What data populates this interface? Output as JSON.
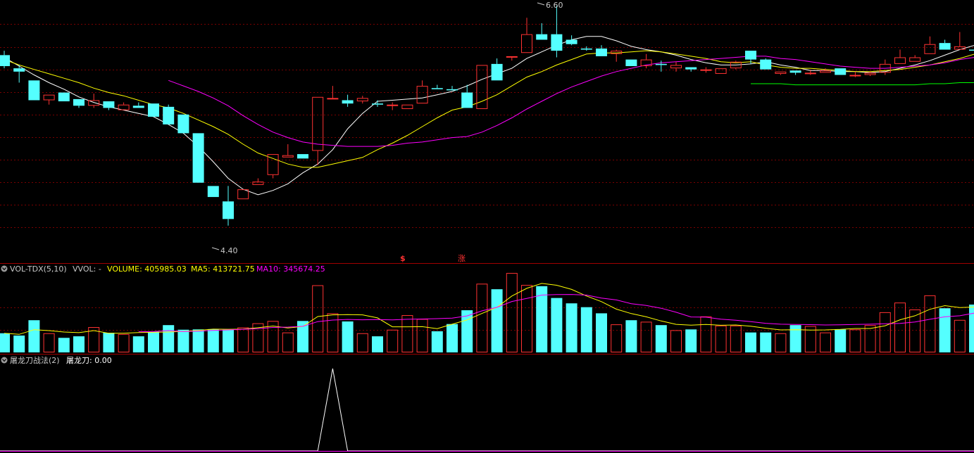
{
  "colors": {
    "background": "#000000",
    "up": "#ff3232",
    "down": "#54ffff",
    "ma_white": "#ffffff",
    "ma_yellow": "#ffff00",
    "ma_magenta": "#ff00ff",
    "ma_green": "#00ff00",
    "grid": "#7a0000",
    "divider": "#a00000",
    "header_gray": "#c8c8c8"
  },
  "price_panel": {
    "high_label": "6.60",
    "low_label": "4.40",
    "markers": [
      "$",
      "涨"
    ]
  },
  "volume_panel": {
    "indicator": "VOL-TDX(5,10)",
    "vvol": "VVOL: -",
    "volume": "VOLUME: 405985.03",
    "ma5": "MA5: 413721.75",
    "ma10": "MA10: 345674.25"
  },
  "signal_panel": {
    "indicator": "屠龙刀战法(2)",
    "value": "屠龙刀: 0.00"
  },
  "chart_data": [
    {
      "type": "candlestick",
      "price_axis_range": [
        4.4,
        6.6
      ],
      "high_annotation": 6.6,
      "low_annotation": 4.4,
      "candles": [
        [
          6.15,
          6.05,
          6.19,
          6.03
        ],
        [
          6.03,
          6.0,
          6.06,
          5.9
        ],
        [
          5.92,
          5.74,
          5.92,
          5.74
        ],
        [
          5.74,
          5.79,
          5.79,
          5.7
        ],
        [
          5.81,
          5.73,
          5.81,
          5.73
        ],
        [
          5.75,
          5.69,
          5.75,
          5.67
        ],
        [
          5.69,
          5.74,
          5.8,
          5.67
        ],
        [
          5.73,
          5.67,
          5.73,
          5.65
        ],
        [
          5.65,
          5.7,
          5.72,
          5.65
        ],
        [
          5.69,
          5.67,
          5.72,
          5.67
        ],
        [
          5.71,
          5.59,
          5.71,
          5.59
        ],
        [
          5.68,
          5.52,
          5.7,
          5.52
        ],
        [
          5.61,
          5.44,
          5.61,
          5.44
        ],
        [
          5.44,
          4.99,
          5.44,
          4.99
        ],
        [
          4.96,
          4.86,
          4.96,
          4.86
        ],
        [
          4.82,
          4.66,
          4.96,
          4.6
        ],
        [
          4.84,
          4.93,
          4.93,
          4.84
        ],
        [
          4.97,
          5.0,
          5.03,
          4.97
        ],
        [
          5.06,
          5.25,
          5.25,
          5.03
        ],
        [
          5.22,
          5.24,
          5.34,
          5.22
        ],
        [
          5.25,
          5.21,
          5.25,
          5.21
        ],
        [
          5.28,
          5.77,
          5.77,
          5.15
        ],
        [
          5.75,
          5.76,
          5.87,
          5.75
        ],
        [
          5.74,
          5.71,
          5.79,
          5.68
        ],
        [
          5.73,
          5.76,
          5.78,
          5.71
        ],
        [
          5.71,
          5.7,
          5.74,
          5.68
        ],
        [
          5.69,
          5.7,
          5.72,
          5.65
        ],
        [
          5.66,
          5.7,
          5.7,
          5.66
        ],
        [
          5.71,
          5.87,
          5.92,
          5.71
        ],
        [
          5.85,
          5.84,
          5.88,
          5.84
        ],
        [
          5.84,
          5.83,
          5.87,
          5.83
        ],
        [
          5.81,
          5.67,
          5.88,
          5.67
        ],
        [
          5.66,
          6.06,
          6.06,
          5.66
        ],
        [
          6.07,
          5.92,
          6.12,
          5.92
        ],
        [
          6.13,
          6.14,
          6.14,
          6.1
        ],
        [
          6.17,
          6.34,
          6.49,
          6.17
        ],
        [
          6.34,
          6.29,
          6.44,
          6.29
        ],
        [
          6.34,
          6.19,
          6.6,
          6.13
        ],
        [
          6.29,
          6.25,
          6.33,
          6.24
        ],
        [
          6.21,
          6.2,
          6.23,
          6.19
        ],
        [
          6.21,
          6.14,
          6.24,
          6.14
        ],
        [
          6.16,
          6.19,
          6.2,
          6.09
        ],
        [
          6.11,
          6.05,
          6.11,
          6.05
        ],
        [
          6.05,
          6.11,
          6.16,
          6.03
        ],
        [
          6.07,
          6.06,
          6.1,
          6.0
        ],
        [
          6.03,
          6.06,
          6.09,
          6.0
        ],
        [
          6.04,
          6.02,
          6.04,
          6.0
        ],
        [
          6.01,
          6.02,
          6.04,
          5.99
        ],
        [
          5.98,
          6.03,
          6.03,
          5.98
        ],
        [
          6.03,
          6.09,
          6.1,
          6.02
        ],
        [
          6.19,
          6.11,
          6.19,
          6.07
        ],
        [
          6.11,
          6.02,
          6.12,
          6.02
        ],
        [
          5.98,
          6.0,
          6.0,
          5.97
        ],
        [
          6.01,
          5.99,
          6.01,
          5.97
        ],
        [
          5.99,
          5.99,
          6.01,
          5.97
        ],
        [
          5.99,
          6.01,
          6.03,
          5.99
        ],
        [
          6.03,
          5.97,
          6.03,
          5.97
        ],
        [
          5.97,
          5.97,
          6.0,
          5.95
        ],
        [
          5.97,
          5.99,
          6.0,
          5.96
        ],
        [
          5.99,
          6.07,
          6.11,
          5.97
        ],
        [
          6.07,
          6.13,
          6.2,
          6.07
        ],
        [
          6.09,
          6.13,
          6.15,
          6.09
        ],
        [
          6.16,
          6.25,
          6.32,
          6.16
        ],
        [
          6.26,
          6.2,
          6.29,
          6.2
        ],
        [
          6.2,
          6.23,
          6.36,
          6.2
        ],
        [
          6.2,
          6.19,
          6.34,
          6.18
        ],
        [
          6.23,
          6.29,
          6.35,
          6.19
        ]
      ],
      "ma_lines": [
        {
          "color": "white",
          "values": [
            6.13,
            6.05,
            5.97,
            5.9,
            5.84,
            5.77,
            5.72,
            5.68,
            5.65,
            5.62,
            5.59,
            5.52,
            5.44,
            5.32,
            5.18,
            5.03,
            4.93,
            4.88,
            4.92,
            4.98,
            5.08,
            5.16,
            5.29,
            5.48,
            5.62,
            5.73,
            5.74,
            5.75,
            5.76,
            5.79,
            5.82,
            5.87,
            5.93,
            5.98,
            6.03,
            6.12,
            6.18,
            6.24,
            6.29,
            6.32,
            6.32,
            6.28,
            6.23,
            6.2,
            6.18,
            6.15,
            6.11,
            6.08,
            6.06,
            6.06,
            6.07,
            6.09,
            6.06,
            6.04,
            6.01,
            6.01,
            6.0,
            6.0,
            5.99,
            6.0,
            6.03,
            6.06,
            6.1,
            6.15,
            6.2,
            6.24,
            6.25
          ]
        },
        {
          "color": "yellow",
          "values": [
            6.11,
            6.06,
            6.02,
            5.98,
            5.94,
            5.9,
            5.85,
            5.81,
            5.78,
            5.74,
            5.7,
            5.67,
            5.62,
            5.56,
            5.5,
            5.43,
            5.34,
            5.26,
            5.21,
            5.16,
            5.13,
            5.13,
            5.16,
            5.19,
            5.22,
            5.29,
            5.35,
            5.42,
            5.5,
            5.58,
            5.65,
            5.68,
            5.73,
            5.79,
            5.87,
            5.95,
            6.0,
            6.06,
            6.11,
            6.16,
            6.17,
            6.17,
            6.18,
            6.19,
            6.18,
            6.16,
            6.14,
            6.12,
            6.09,
            6.08,
            6.09,
            6.06,
            6.04,
            6.03,
            6.03,
            6.02,
            6.01,
            6.0,
            6.0,
            6.01,
            6.02,
            6.04,
            6.06,
            6.09,
            6.12,
            6.16,
            6.2
          ]
        },
        {
          "color": "magenta",
          "values": [
            null,
            null,
            null,
            null,
            null,
            null,
            null,
            null,
            null,
            null,
            null,
            5.92,
            5.87,
            5.82,
            5.76,
            5.69,
            5.6,
            5.52,
            5.45,
            5.4,
            5.36,
            5.34,
            5.33,
            5.32,
            5.32,
            5.32,
            5.33,
            5.35,
            5.36,
            5.38,
            5.4,
            5.41,
            5.45,
            5.51,
            5.58,
            5.66,
            5.73,
            5.8,
            5.86,
            5.91,
            5.96,
            6.0,
            6.03,
            6.06,
            6.08,
            6.09,
            6.1,
            6.11,
            6.12,
            6.13,
            6.14,
            6.14,
            6.12,
            6.11,
            6.09,
            6.07,
            6.05,
            6.04,
            6.03,
            6.03,
            6.04,
            6.05,
            6.06,
            6.08,
            6.11,
            6.13,
            6.15
          ]
        },
        {
          "color": "green",
          "values": [
            null,
            null,
            null,
            null,
            null,
            null,
            null,
            null,
            null,
            null,
            null,
            null,
            null,
            null,
            null,
            null,
            null,
            null,
            null,
            null,
            null,
            null,
            null,
            null,
            null,
            null,
            null,
            null,
            null,
            null,
            null,
            null,
            null,
            null,
            null,
            null,
            null,
            null,
            null,
            null,
            null,
            null,
            null,
            null,
            null,
            null,
            null,
            null,
            null,
            null,
            5.89,
            5.89,
            5.89,
            5.88,
            5.88,
            5.88,
            5.88,
            5.88,
            5.88,
            5.88,
            5.88,
            5.88,
            5.89,
            5.89,
            5.9,
            5.9,
            5.91
          ]
        }
      ],
      "signal_markers": [
        {
          "index": 26,
          "label": "$"
        },
        {
          "index": 30,
          "label": "涨"
        }
      ]
    },
    {
      "type": "bar",
      "title": "VOL-TDX(5,10)",
      "volume_range": [
        0,
        500000
      ],
      "values": [
        125000,
        110000,
        210000,
        125000,
        95000,
        105000,
        165000,
        128000,
        120000,
        105000,
        135000,
        178000,
        148000,
        150000,
        152000,
        148000,
        163000,
        190000,
        205000,
        130000,
        205000,
        438000,
        255000,
        202000,
        125000,
        105000,
        148000,
        243000,
        218000,
        138000,
        185000,
        275000,
        448000,
        412000,
        518000,
        440000,
        432000,
        355000,
        320000,
        295000,
        255000,
        183000,
        210000,
        200000,
        178000,
        145000,
        150000,
        235000,
        175000,
        175000,
        130000,
        130000,
        125000,
        178000,
        172000,
        130000,
        150000,
        150000,
        178000,
        262000,
        325000,
        280000,
        372000,
        288000,
        212000,
        312000,
        310000
      ],
      "ma5": [
        125000,
        118000,
        148000,
        142000,
        133000,
        129000,
        142000,
        125000,
        125000,
        130000,
        131000,
        133000,
        137000,
        143000,
        152000,
        151000,
        152000,
        161000,
        172000,
        159000,
        169000,
        234000,
        245000,
        247000,
        245000,
        225000,
        167000,
        167000,
        168000,
        155000,
        184000,
        212000,
        254000,
        294000,
        368000,
        418000,
        450000,
        438000,
        411000,
        368000,
        331000,
        282000,
        253000,
        232000,
        205000,
        183000,
        178000,
        182000,
        177000,
        179000,
        171000,
        158000,
        147000,
        148000,
        146000,
        147000,
        150000,
        156000,
        156000,
        174000,
        213000,
        239000,
        281000,
        305000,
        292000,
        296000,
        298000
      ],
      "ma10": [
        null,
        null,
        null,
        null,
        null,
        null,
        null,
        null,
        null,
        135000,
        136000,
        142000,
        136000,
        139000,
        143000,
        147000,
        151000,
        155000,
        163000,
        165000,
        170000,
        201000,
        211000,
        215000,
        213000,
        214000,
        212000,
        216000,
        218000,
        220000,
        224000,
        238000,
        271000,
        294000,
        332000,
        352000,
        374000,
        377000,
        378000,
        374000,
        354000,
        342000,
        318000,
        306000,
        288000,
        262000,
        231000,
        230000,
        217000,
        210000,
        201000,
        190000,
        184000,
        182000,
        181000,
        179000,
        180000,
        182000,
        184000,
        187000,
        189000,
        198000,
        216000,
        232000,
        239000,
        257000,
        280000
      ]
    },
    {
      "type": "line",
      "title": "屠龙刀战法(2)",
      "values": [
        0,
        0,
        0,
        0,
        0,
        0,
        0,
        0,
        0,
        0,
        0,
        0,
        0,
        0,
        0,
        0,
        0,
        0,
        0,
        0,
        0,
        0,
        1,
        0,
        0,
        0,
        0,
        0,
        0,
        0,
        0,
        0,
        0,
        0,
        0,
        0,
        0,
        0,
        0,
        0,
        0,
        0,
        0,
        0,
        0,
        0,
        0,
        0,
        0,
        0,
        0,
        0,
        0,
        0,
        0,
        0,
        0,
        0,
        0,
        0,
        0,
        0,
        0,
        0,
        0,
        0,
        0
      ],
      "last_value": 0.0
    }
  ]
}
